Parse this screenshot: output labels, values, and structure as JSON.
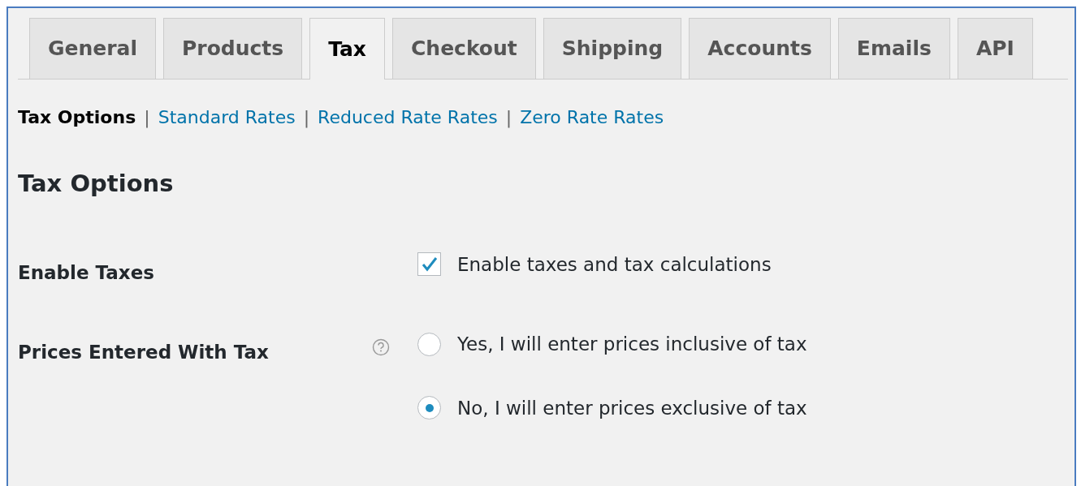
{
  "tabs": [
    {
      "label": "General",
      "selected": false
    },
    {
      "label": "Products",
      "selected": false
    },
    {
      "label": "Tax",
      "selected": true
    },
    {
      "label": "Checkout",
      "selected": false
    },
    {
      "label": "Shipping",
      "selected": false
    },
    {
      "label": "Accounts",
      "selected": false
    },
    {
      "label": "Emails",
      "selected": false
    },
    {
      "label": "API",
      "selected": false
    }
  ],
  "subnav": [
    {
      "label": "Tax Options",
      "selected": true
    },
    {
      "label": "Standard Rates",
      "selected": false
    },
    {
      "label": "Reduced Rate Rates",
      "selected": false
    },
    {
      "label": "Zero Rate Rates",
      "selected": false
    }
  ],
  "separator": "|",
  "heading": "Tax Options",
  "settings": [
    {
      "kind": "checkbox",
      "label": "Enable Taxes",
      "help": false,
      "options": [
        {
          "label": "Enable taxes and tax calculations",
          "checked": true
        }
      ]
    },
    {
      "kind": "radio",
      "label": "Prices Entered With Tax",
      "help": true,
      "options": [
        {
          "label": "Yes, I will enter prices inclusive of tax",
          "selected": false
        },
        {
          "label": "No, I will enter prices exclusive of tax",
          "selected": true
        }
      ]
    }
  ]
}
